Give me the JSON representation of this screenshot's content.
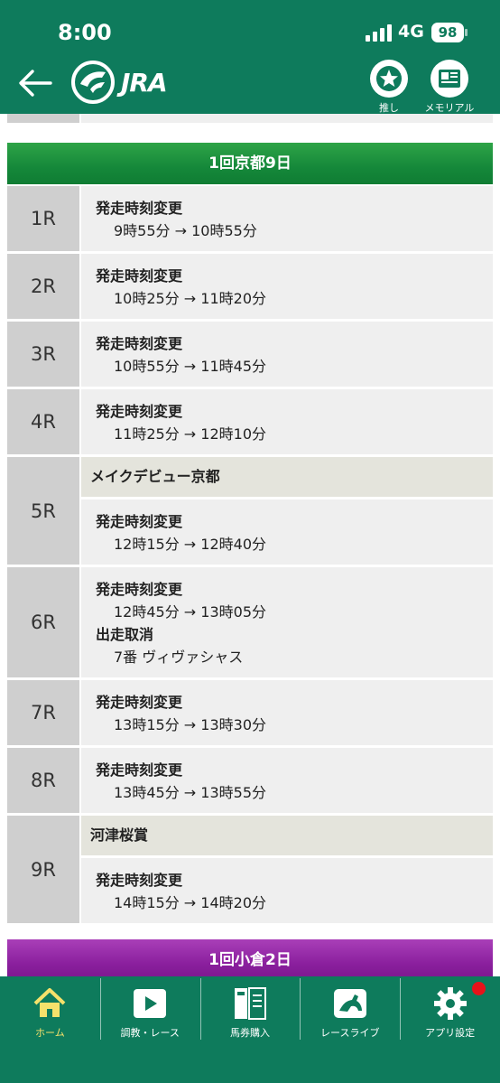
{
  "status_bar": {
    "time": "8:00",
    "network": "4G",
    "battery": "98"
  },
  "header": {
    "logo_text": "JRA",
    "oshi_label": "推し",
    "memorial_label": "メモリアル"
  },
  "venues": [
    {
      "name": "1回京都9日",
      "color": "#15883a"
    },
    {
      "name": "1回小倉2日",
      "color": "#8a1f9d"
    }
  ],
  "races": [
    {
      "num": "1R",
      "title": null,
      "changes": [
        {
          "label": "発走時刻変更",
          "value": "9時55分 → 10時55分"
        }
      ]
    },
    {
      "num": "2R",
      "title": null,
      "changes": [
        {
          "label": "発走時刻変更",
          "value": "10時25分 → 11時20分"
        }
      ]
    },
    {
      "num": "3R",
      "title": null,
      "changes": [
        {
          "label": "発走時刻変更",
          "value": "10時55分 → 11時45分"
        }
      ]
    },
    {
      "num": "4R",
      "title": null,
      "changes": [
        {
          "label": "発走時刻変更",
          "value": "11時25分 → 12時10分"
        }
      ]
    },
    {
      "num": "5R",
      "title": "メイクデビュー京都",
      "changes": [
        {
          "label": "発走時刻変更",
          "value": "12時15分 → 12時40分"
        }
      ]
    },
    {
      "num": "6R",
      "title": null,
      "changes": [
        {
          "label": "発走時刻変更",
          "value": "12時45分 → 13時05分"
        },
        {
          "label": "出走取消",
          "value": "7番 ヴィヴァシャス"
        }
      ]
    },
    {
      "num": "7R",
      "title": null,
      "changes": [
        {
          "label": "発走時刻変更",
          "value": "13時15分 → 13時30分"
        }
      ]
    },
    {
      "num": "8R",
      "title": null,
      "changes": [
        {
          "label": "発走時刻変更",
          "value": "13時45分 → 13時55分"
        }
      ]
    },
    {
      "num": "9R",
      "title": "河津桜賞",
      "changes": [
        {
          "label": "発走時刻変更",
          "value": "14時15分 → 14時20分"
        }
      ]
    }
  ],
  "bottom_nav": [
    {
      "label": "ホーム",
      "icon": "home-icon",
      "active": true
    },
    {
      "label": "調教・レース",
      "icon": "play-icon",
      "active": false
    },
    {
      "label": "馬券購入",
      "icon": "ticket-icon",
      "active": false
    },
    {
      "label": "レースライブ",
      "icon": "race-live-icon",
      "active": false
    },
    {
      "label": "アプリ設定",
      "icon": "gear-icon",
      "active": false,
      "badge": true
    }
  ],
  "colors": {
    "brand": "#0e7b5c",
    "active_nav": "#f5e16b",
    "badge": "#e8121a"
  }
}
